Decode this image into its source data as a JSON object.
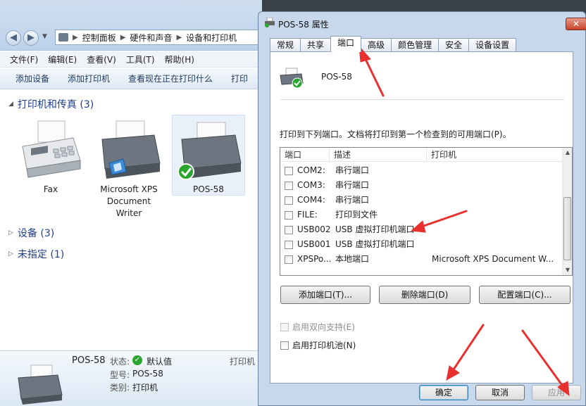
{
  "explorer": {
    "breadcrumb": [
      "控制面板",
      "硬件和声音",
      "设备和打印机"
    ],
    "menu": [
      "文件(F)",
      "编辑(E)",
      "查看(V)",
      "工具(T)",
      "帮助(H)"
    ],
    "commands": [
      "添加设备",
      "添加打印机",
      "查看现在正在打印什么",
      "打印"
    ],
    "group_printers": "打印机和传真 (3)",
    "group_devices": "设备 (3)",
    "group_unspecified": "未指定 (1)",
    "devices": [
      {
        "name": "Fax"
      },
      {
        "name": "Microsoft XPS Document Writer"
      },
      {
        "name": "POS-58"
      }
    ],
    "details": {
      "name": "POS-58",
      "status_label": "状态:",
      "status_value": "默认值",
      "model_label": "型号:",
      "model_value": "POS-58",
      "category_label": "类别:",
      "category_value": "打印机",
      "print_label": "打印机"
    }
  },
  "dialog": {
    "title": "POS-58 属性",
    "tabs": [
      "常规",
      "共享",
      "端口",
      "高级",
      "颜色管理",
      "安全",
      "设备设置"
    ],
    "printer_name": "POS-58",
    "instruction": "打印到下列端口。文档将打印到第一个检查到的可用端口(P)。",
    "columns": {
      "port": "端口",
      "desc": "描述",
      "printer": "打印机"
    },
    "ports": [
      {
        "port": "COM2:",
        "desc": "串行端口",
        "printer": ""
      },
      {
        "port": "COM3:",
        "desc": "串行端口",
        "printer": ""
      },
      {
        "port": "COM4:",
        "desc": "串行端口",
        "printer": ""
      },
      {
        "port": "FILE:",
        "desc": "打印到文件",
        "printer": ""
      },
      {
        "port": "USB002",
        "desc": "USB 虚拟打印机端口",
        "printer": ""
      },
      {
        "port": "USB001",
        "desc": "USB 虚拟打印机端口",
        "printer": ""
      },
      {
        "port": "XPSPo...",
        "desc": "本地端口",
        "printer": "Microsoft XPS Document W..."
      }
    ],
    "buttons": {
      "add": "添加端口(T)...",
      "delete": "删除端口(D)",
      "config": "配置端口(C)..."
    },
    "bidi": "启用双向支持(E)",
    "pool": "启用打印机池(N)",
    "ok": "确定",
    "cancel": "取消",
    "apply": "应用"
  },
  "colors": {
    "annotation_arrow": "#e8312f",
    "link_blue": "#1e3f8a"
  }
}
